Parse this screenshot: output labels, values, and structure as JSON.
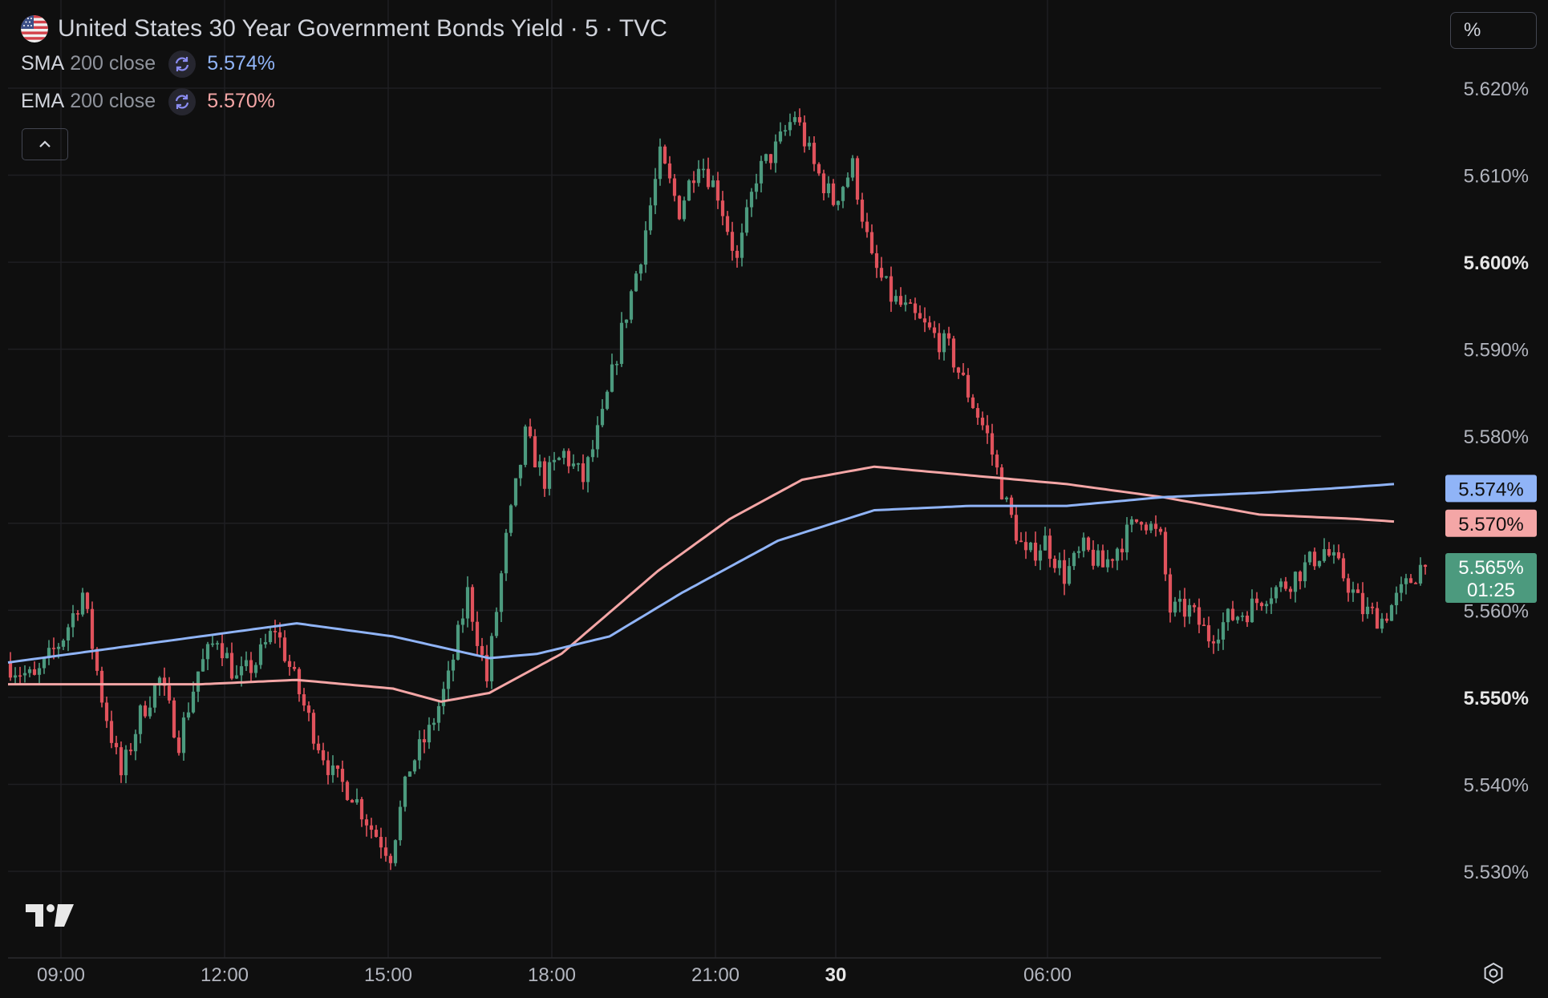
{
  "header": {
    "title": "United States 30 Year Government Bonds Yield · 5 · TVC",
    "indicators": [
      {
        "name": "SMA",
        "params": "200 close",
        "value": "5.574%",
        "color": "#90b4f7"
      },
      {
        "name": "EMA",
        "params": "200 close",
        "value": "5.570%",
        "color": "#f4a6a6"
      }
    ]
  },
  "toolbar": {
    "scale_mode_label": "%",
    "collapse_icon": "chevron-up-icon",
    "settings_icon": "gear-icon",
    "logo_icon": "tradingview-logo-icon"
  },
  "price_badges": {
    "sma": {
      "label": "5.574%",
      "color": "#90b4f7"
    },
    "ema": {
      "label": "5.570%",
      "color": "#f4a6a6"
    },
    "last": {
      "label": "5.565%",
      "countdown": "01:25",
      "color": "#4c9a7e"
    }
  },
  "chart_data": {
    "type": "candlestick",
    "title": "United States 30 Year Government Bonds Yield · 5 · TVC",
    "interval": "5",
    "ylim": [
      5.526,
      5.626
    ],
    "y_ticks": [
      "5.620%",
      "5.610%",
      "5.600%",
      "5.590%",
      "5.580%",
      "5.570%",
      "5.560%",
      "5.550%",
      "5.540%",
      "5.530%"
    ],
    "y_ticks_bold": [
      "5.600%",
      "5.550%"
    ],
    "x_ticks": [
      "09:00",
      "12:00",
      "15:00",
      "18:00",
      "21:00",
      "30",
      "06:00"
    ],
    "x_ticks_bold": [
      "30"
    ],
    "grid": true,
    "up_color": "#4c9a7e",
    "down_color": "#e0525c",
    "path": [
      [
        0,
        5.554
      ],
      [
        6,
        5.552
      ],
      [
        12,
        5.557
      ],
      [
        16,
        5.562
      ],
      [
        20,
        5.55
      ],
      [
        24,
        5.541
      ],
      [
        28,
        5.548
      ],
      [
        32,
        5.552
      ],
      [
        36,
        5.545
      ],
      [
        40,
        5.553
      ],
      [
        44,
        5.557
      ],
      [
        48,
        5.552
      ],
      [
        52,
        5.554
      ],
      [
        56,
        5.558
      ],
      [
        60,
        5.552
      ],
      [
        64,
        5.546
      ],
      [
        68,
        5.541
      ],
      [
        72,
        5.539
      ],
      [
        76,
        5.535
      ],
      [
        80,
        5.532
      ],
      [
        84,
        5.542
      ],
      [
        88,
        5.546
      ],
      [
        92,
        5.552
      ],
      [
        96,
        5.562
      ],
      [
        100,
        5.552
      ],
      [
        104,
        5.568
      ],
      [
        108,
        5.58
      ],
      [
        112,
        5.575
      ],
      [
        116,
        5.578
      ],
      [
        120,
        5.575
      ],
      [
        124,
        5.582
      ],
      [
        128,
        5.592
      ],
      [
        132,
        5.601
      ],
      [
        136,
        5.612
      ],
      [
        140,
        5.606
      ],
      [
        144,
        5.612
      ],
      [
        148,
        5.608
      ],
      [
        152,
        5.6
      ],
      [
        156,
        5.61
      ],
      [
        160,
        5.613
      ],
      [
        164,
        5.617
      ],
      [
        168,
        5.611
      ],
      [
        172,
        5.607
      ],
      [
        176,
        5.611
      ],
      [
        180,
        5.6
      ],
      [
        184,
        5.596
      ],
      [
        188,
        5.594
      ],
      [
        192,
        5.592
      ],
      [
        196,
        5.59
      ],
      [
        200,
        5.585
      ],
      [
        204,
        5.58
      ],
      [
        208,
        5.572
      ],
      [
        212,
        5.566
      ],
      [
        216,
        5.568
      ],
      [
        220,
        5.564
      ],
      [
        224,
        5.567
      ],
      [
        228,
        5.565
      ],
      [
        232,
        5.568
      ],
      [
        236,
        5.571
      ],
      [
        240,
        5.568
      ],
      [
        242,
        5.56
      ],
      [
        246,
        5.56
      ],
      [
        250,
        5.557
      ],
      [
        254,
        5.559
      ],
      [
        258,
        5.56
      ],
      [
        262,
        5.562
      ],
      [
        266,
        5.563
      ],
      [
        270,
        5.565
      ],
      [
        274,
        5.567
      ],
      [
        278,
        5.564
      ],
      [
        282,
        5.56
      ],
      [
        286,
        5.559
      ],
      [
        290,
        5.562
      ],
      [
        294,
        5.565
      ]
    ],
    "sma_path": [
      [
        0,
        5.554
      ],
      [
        40,
        5.557
      ],
      [
        60,
        5.5585
      ],
      [
        80,
        5.557
      ],
      [
        100,
        5.5545
      ],
      [
        110,
        5.555
      ],
      [
        125,
        5.557
      ],
      [
        140,
        5.562
      ],
      [
        160,
        5.568
      ],
      [
        180,
        5.5715
      ],
      [
        200,
        5.572
      ],
      [
        220,
        5.572
      ],
      [
        240,
        5.573
      ],
      [
        260,
        5.5735
      ],
      [
        275,
        5.574
      ],
      [
        288,
        5.5745
      ]
    ],
    "ema_path": [
      [
        0,
        5.5515
      ],
      [
        40,
        5.5515
      ],
      [
        60,
        5.552
      ],
      [
        80,
        5.551
      ],
      [
        90,
        5.5495
      ],
      [
        100,
        5.5505
      ],
      [
        115,
        5.555
      ],
      [
        135,
        5.5645
      ],
      [
        150,
        5.5705
      ],
      [
        165,
        5.575
      ],
      [
        180,
        5.5765
      ],
      [
        200,
        5.5755
      ],
      [
        220,
        5.5745
      ],
      [
        240,
        5.573
      ],
      [
        260,
        5.571
      ],
      [
        280,
        5.5705
      ],
      [
        288,
        5.5702
      ]
    ]
  }
}
